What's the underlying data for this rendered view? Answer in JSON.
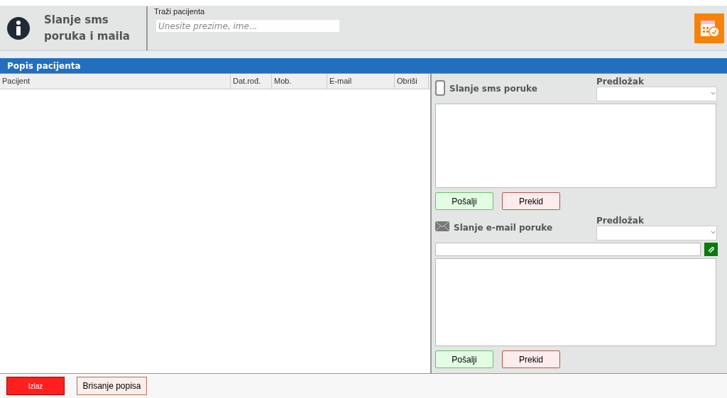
{
  "header": {
    "title_line1": "Slanje sms",
    "title_line2": "poruka i maila",
    "search_label": "Traži pacijenta",
    "search_placeholder": "Unesite prezime, ime..."
  },
  "patient_list": {
    "title": "Popis pacijenta",
    "columns": [
      "Pacijent",
      "Dat.rođ.",
      "Mob.",
      "E-mail",
      "Obriši"
    ]
  },
  "sms": {
    "title": "Slanje sms poruke",
    "template_label": "Predložak",
    "send": "Pošalji",
    "cancel": "Prekid"
  },
  "email": {
    "title": "Slanje e-mail poruke",
    "template_label": "Predložak",
    "send": "Pošalji",
    "cancel": "Prekid"
  },
  "footer": {
    "exit": "Izlaz",
    "clear": "Brisanje popisa"
  }
}
